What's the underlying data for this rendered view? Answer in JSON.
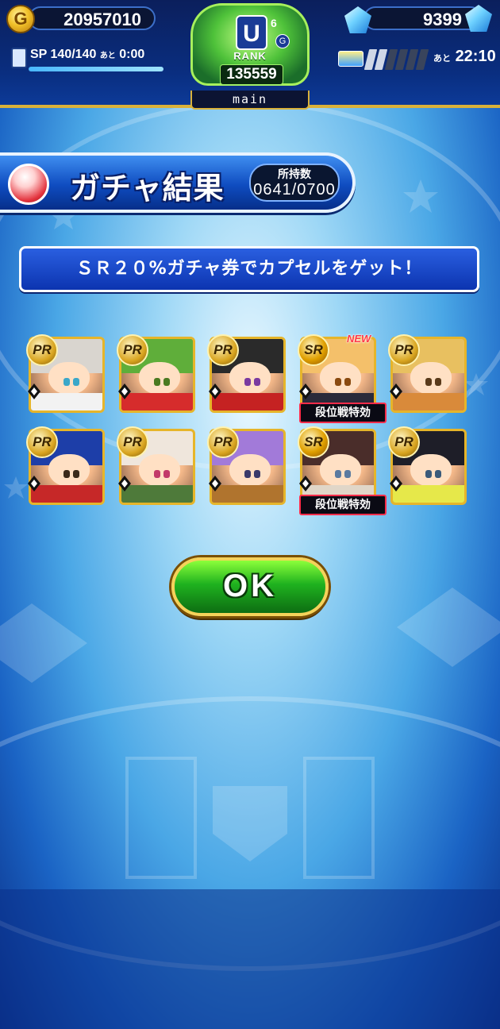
{
  "hud": {
    "coins": "20957010",
    "coin_icon_letter": "G",
    "gems": "9399",
    "sp_label": "SP",
    "sp_value": "140/140",
    "sp_fill_fraction": 1.0,
    "sp_remain_prefix": "あと",
    "sp_remain_time": "0:00",
    "rank_letter": "U",
    "rank_level": "6",
    "rank_sub": "G",
    "rank_word": "RANK",
    "rank_points": "135559",
    "main_tab": "main",
    "stamina_bars_filled": 2,
    "stamina_bars_total": 6,
    "stamina_remain_prefix": "あと",
    "stamina_remain_time": "22:10"
  },
  "title": {
    "text": "ガチャ結果",
    "owned_label": "所持数",
    "owned_value": "0641/0700"
  },
  "banner": {
    "text": "ＳＲ２０%ガチャ券でカプセルをゲット！"
  },
  "cards": [
    {
      "rarity": "PR",
      "hair": "#d9d5cf",
      "shirt": "#f2f2f2",
      "eye": "#3aa7c9",
      "new": "",
      "tag": ""
    },
    {
      "rarity": "PR",
      "hair": "#5fae3a",
      "shirt": "#d62c2c",
      "eye": "#4a7a20",
      "new": "",
      "tag": ""
    },
    {
      "rarity": "PR",
      "hair": "#2a2a2a",
      "shirt": "#c52222",
      "eye": "#7a3aa0",
      "new": "",
      "tag": ""
    },
    {
      "rarity": "SR",
      "hair": "#f4c06a",
      "shirt": "#2a2a3a",
      "eye": "#8a4a10",
      "new": "NEW",
      "tag": "段位戦特効"
    },
    {
      "rarity": "PR",
      "hair": "#e8c060",
      "shirt": "#d98a3a",
      "eye": "#5a3a1a",
      "new": "",
      "tag": ""
    },
    {
      "rarity": "PR",
      "hair": "#1d3ea8",
      "shirt": "#c62828",
      "eye": "#3a2a1a",
      "new": "",
      "tag": ""
    },
    {
      "rarity": "PR",
      "hair": "#efe6dc",
      "shirt": "#4e7a3a",
      "eye": "#c23a6a",
      "new": "",
      "tag": ""
    },
    {
      "rarity": "PR",
      "hair": "#a27ad9",
      "shirt": "#b0742e",
      "eye": "#3a3a6a",
      "new": "",
      "tag": ""
    },
    {
      "rarity": "SR",
      "hair": "#4a2d2a",
      "shirt": "#e0d6c8",
      "eye": "#5a7aa0",
      "new": "",
      "tag": "段位戦特効"
    },
    {
      "rarity": "PR",
      "hair": "#1e1e28",
      "shirt": "#e6e84a",
      "eye": "#3a5a7a",
      "new": "",
      "tag": ""
    }
  ],
  "ok_button": {
    "label": "OK"
  }
}
